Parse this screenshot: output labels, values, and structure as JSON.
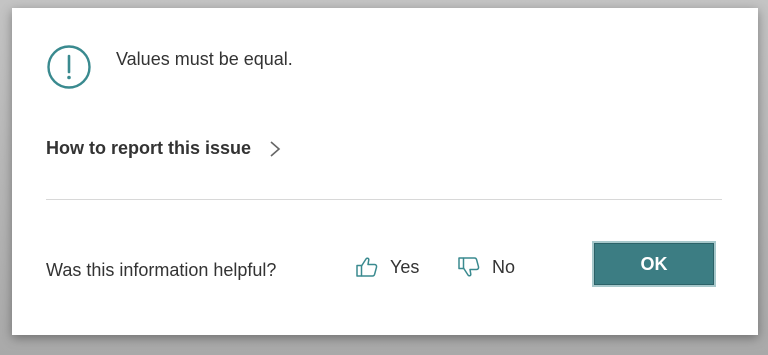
{
  "dialog": {
    "message": "Values must be equal.",
    "message_icon": "exclamation-circle-icon",
    "report_link": {
      "label": "How to report this issue",
      "icon": "chevron-right-icon"
    },
    "feedback": {
      "question": "Was this information helpful?",
      "yes_label": "Yes",
      "yes_icon": "thumbs-up-icon",
      "no_label": "No",
      "no_icon": "thumbs-down-icon"
    },
    "ok_label": "OK"
  },
  "colors": {
    "accent": "#3c7d83",
    "accent_icon": "#3a8a8f",
    "text": "#333333",
    "divider": "#d8d8d8"
  }
}
